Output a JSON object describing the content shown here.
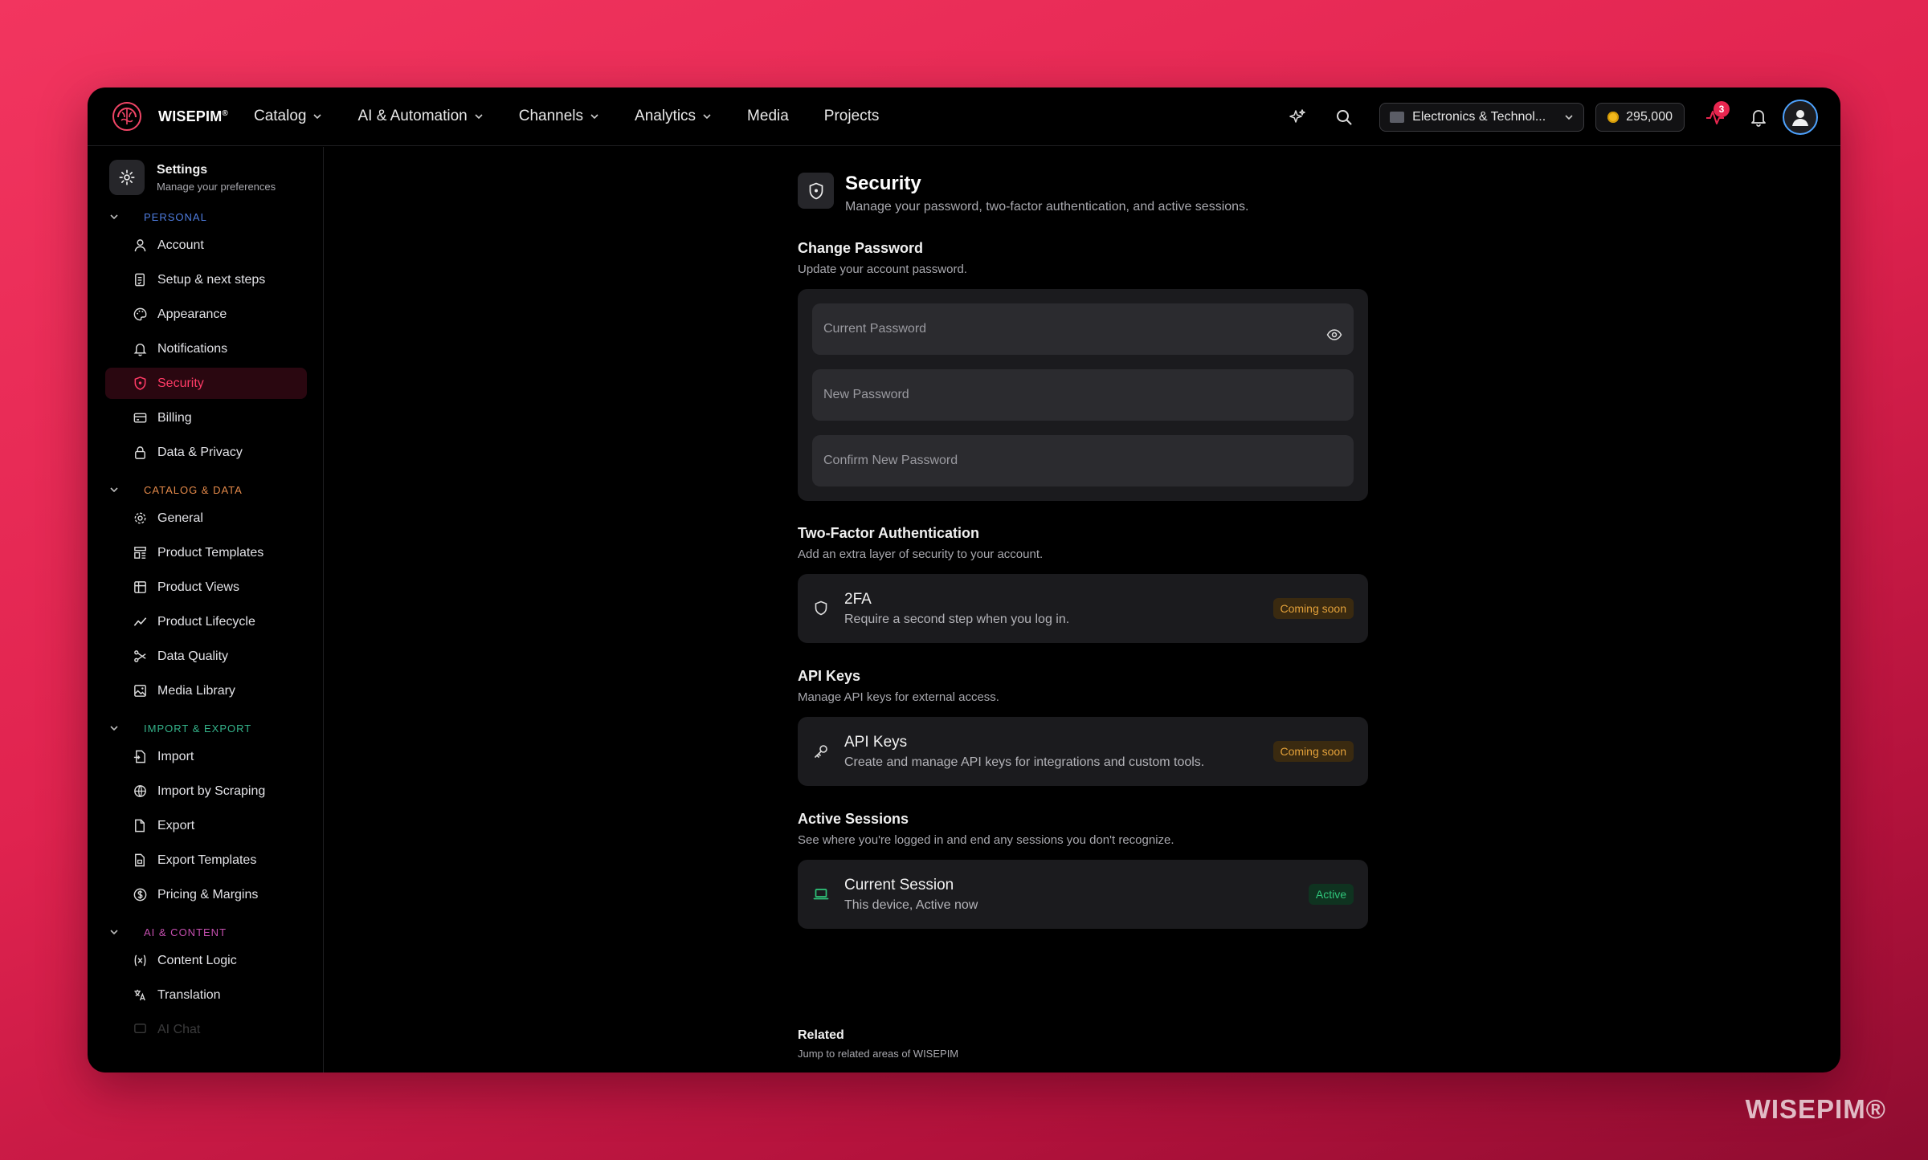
{
  "app": {
    "name": "WISEPIM",
    "reg": "®"
  },
  "nav": {
    "items": [
      {
        "label": "Catalog",
        "dropdown": true
      },
      {
        "label": "AI & Automation",
        "dropdown": true
      },
      {
        "label": "Channels",
        "dropdown": true
      },
      {
        "label": "Analytics",
        "dropdown": true
      },
      {
        "label": "Media",
        "dropdown": false
      },
      {
        "label": "Projects",
        "dropdown": false
      }
    ]
  },
  "topbar": {
    "workspace": "Electronics & Technol...",
    "credits": "295,000",
    "activity_count": "3"
  },
  "sidebar": {
    "title": "Settings",
    "subtitle": "Manage your preferences",
    "sections": [
      {
        "label": "PERSONAL",
        "color": "#4f7de0",
        "items": [
          {
            "label": "Account",
            "icon": "user-icon"
          },
          {
            "label": "Setup & next steps",
            "icon": "checklist-icon"
          },
          {
            "label": "Appearance",
            "icon": "palette-icon"
          },
          {
            "label": "Notifications",
            "icon": "bell-icon"
          },
          {
            "label": "Security",
            "icon": "shield-icon",
            "active": true
          },
          {
            "label": "Billing",
            "icon": "credit-card-icon"
          },
          {
            "label": "Data & Privacy",
            "icon": "lock-icon"
          }
        ]
      },
      {
        "label": "CATALOG & DATA",
        "color": "#e58a4a",
        "items": [
          {
            "label": "General",
            "icon": "gear-icon"
          },
          {
            "label": "Product Templates",
            "icon": "template-icon"
          },
          {
            "label": "Product Views",
            "icon": "table-icon"
          },
          {
            "label": "Product Lifecycle",
            "icon": "trend-icon"
          },
          {
            "label": "Data Quality",
            "icon": "quality-icon"
          },
          {
            "label": "Media Library",
            "icon": "image-icon"
          }
        ]
      },
      {
        "label": "IMPORT & EXPORT",
        "color": "#34b38a",
        "items": [
          {
            "label": "Import",
            "icon": "file-import-icon"
          },
          {
            "label": "Import by Scraping",
            "icon": "globe-icon"
          },
          {
            "label": "Export",
            "icon": "file-export-icon"
          },
          {
            "label": "Export Templates",
            "icon": "file-template-icon"
          },
          {
            "label": "Pricing & Margins",
            "icon": "dollar-icon"
          }
        ]
      },
      {
        "label": "AI & CONTENT",
        "color": "#c64fb0",
        "items": [
          {
            "label": "Content Logic",
            "icon": "variable-icon"
          },
          {
            "label": "Translation",
            "icon": "translate-icon"
          },
          {
            "label": "AI Chat",
            "icon": "chat-icon"
          }
        ]
      }
    ]
  },
  "page": {
    "title": "Security",
    "subtitle": "Manage your password, two-factor authentication, and active sessions."
  },
  "password": {
    "title": "Change Password",
    "subtitle": "Update your account password.",
    "fields": [
      {
        "placeholder": "Current Password"
      },
      {
        "placeholder": "New Password"
      },
      {
        "placeholder": "Confirm New Password"
      }
    ]
  },
  "twofa": {
    "title": "Two-Factor Authentication",
    "subtitle": "Add an extra layer of security to your account.",
    "row_title": "2FA",
    "row_sub": "Require a second step when you log in.",
    "badge": "Coming soon"
  },
  "apikeys": {
    "title": "API Keys",
    "subtitle": "Manage API keys for external access.",
    "row_title": "API Keys",
    "row_sub": "Create and manage API keys for integrations and custom tools.",
    "badge": "Coming soon"
  },
  "sessions": {
    "title": "Active Sessions",
    "subtitle": "See where you're logged in and end any sessions you don't recognize.",
    "row_title": "Current Session",
    "row_sub": "This device, Active now",
    "badge": "Active"
  },
  "related": {
    "title": "Related",
    "subtitle": "Jump to related areas of WISEPIM"
  },
  "watermark": "WISEPIM®"
}
